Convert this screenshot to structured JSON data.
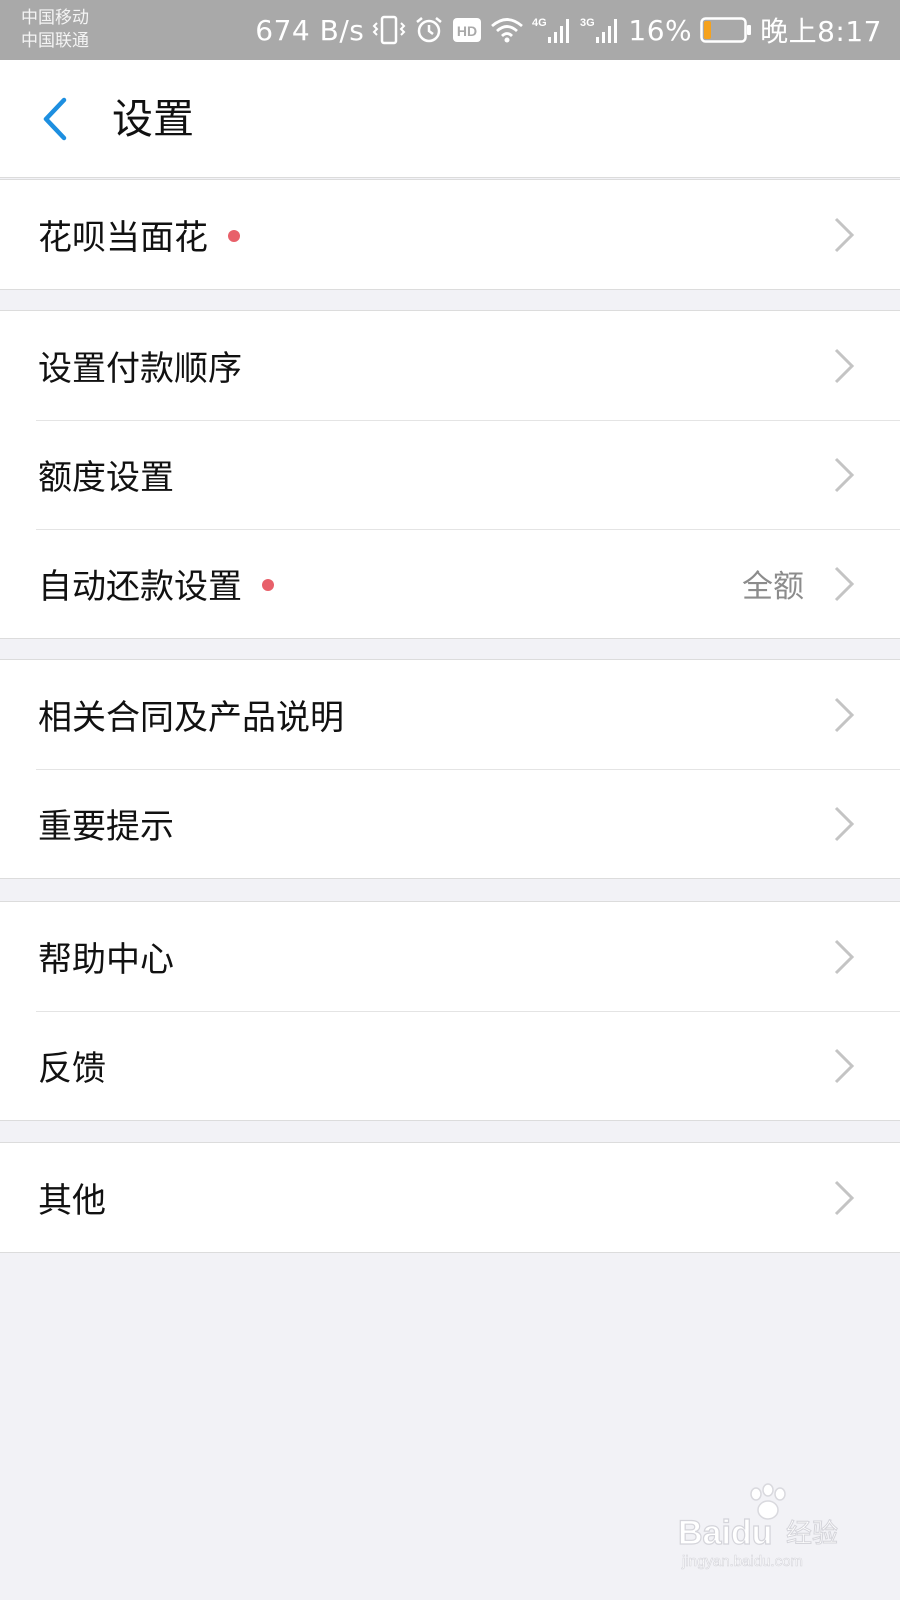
{
  "status_bar": {
    "carrier_1": "中国移动",
    "carrier_2": "中国联通",
    "net_speed": "674 B/s",
    "hd_label": "HD",
    "net_4g": "4G",
    "net_3g": "3G",
    "battery": "16%",
    "time": "晚上8:17",
    "icons": [
      "vibrate-icon",
      "alarm-icon",
      "hd-icon",
      "wifi-icon",
      "signal-4g-icon",
      "signal-3g-icon",
      "battery-icon"
    ],
    "battery_level": 0.16,
    "battery_color": "#f5a21d"
  },
  "nav": {
    "title": "设置",
    "back_icon": "chevron-left-icon",
    "accent": "#1d8fe0"
  },
  "groups": [
    {
      "items": [
        {
          "label": "花呗当面花",
          "dot": true,
          "value": ""
        }
      ]
    },
    {
      "items": [
        {
          "label": "设置付款顺序",
          "dot": false,
          "value": ""
        },
        {
          "label": "额度设置",
          "dot": false,
          "value": ""
        },
        {
          "label": "自动还款设置",
          "dot": true,
          "value": "全额"
        }
      ]
    },
    {
      "items": [
        {
          "label": "相关合同及产品说明",
          "dot": false,
          "value": ""
        },
        {
          "label": "重要提示",
          "dot": false,
          "value": ""
        }
      ]
    },
    {
      "items": [
        {
          "label": "帮助中心",
          "dot": false,
          "value": ""
        },
        {
          "label": "反馈",
          "dot": false,
          "value": ""
        }
      ]
    },
    {
      "items": [
        {
          "label": "其他",
          "dot": false,
          "value": ""
        }
      ]
    }
  ],
  "colors": {
    "dot": "#e8606a",
    "chevron": "#c4c4c4",
    "background": "#f2f2f6"
  },
  "watermark": {
    "brand": "Baidu",
    "cn": "经验",
    "url": "jingyan.baidu.com"
  }
}
